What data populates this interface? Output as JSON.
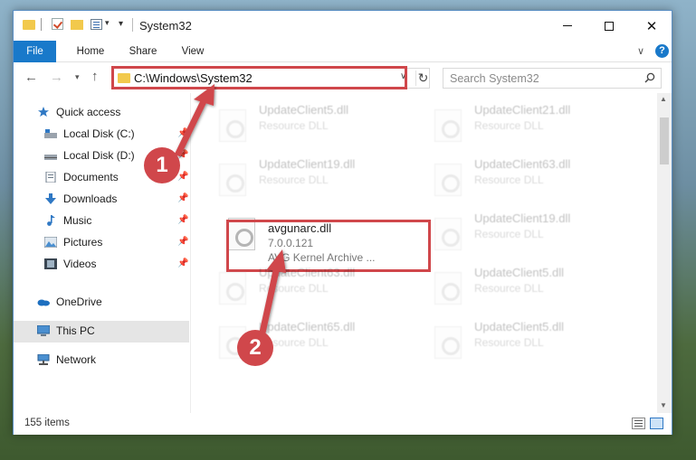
{
  "window": {
    "title": "System32"
  },
  "ribbon": {
    "tabs": [
      {
        "label": "File"
      },
      {
        "label": "Home"
      },
      {
        "label": "Share"
      },
      {
        "label": "View"
      }
    ]
  },
  "address": {
    "path": "C:\\Windows\\System32"
  },
  "search": {
    "placeholder": "Search System32"
  },
  "sidebar": {
    "items": [
      {
        "label": "Quick access",
        "icon": "star-icon",
        "pinned": false
      },
      {
        "label": "Local Disk (C:)",
        "icon": "drive-icon",
        "pinned": true
      },
      {
        "label": "Local Disk (D:)",
        "icon": "drive-icon",
        "pinned": true
      },
      {
        "label": "Documents",
        "icon": "documents-icon",
        "pinned": true
      },
      {
        "label": "Downloads",
        "icon": "downloads-icon",
        "pinned": true
      },
      {
        "label": "Music",
        "icon": "music-icon",
        "pinned": true
      },
      {
        "label": "Pictures",
        "icon": "pictures-icon",
        "pinned": true
      },
      {
        "label": "Videos",
        "icon": "videos-icon",
        "pinned": true
      },
      {
        "label": "OneDrive",
        "icon": "cloud-icon",
        "pinned": false
      },
      {
        "label": "This PC",
        "icon": "computer-icon",
        "pinned": false,
        "selected": true
      },
      {
        "label": "Network",
        "icon": "network-icon",
        "pinned": false
      }
    ]
  },
  "files": [
    {
      "name": "UpdateClient5.dll",
      "line1": "Resource DLL",
      "line2": "",
      "faded": true
    },
    {
      "name": "UpdateClient21.dll",
      "line1": "Resource DLL",
      "line2": "",
      "faded": true
    },
    {
      "name": "UpdateClient19.dll",
      "line1": "Resource DLL",
      "line2": "",
      "faded": true
    },
    {
      "name": "UpdateClient63.dll",
      "line1": "Resource DLL",
      "line2": "",
      "faded": true
    },
    {
      "name": "avgunarc.dll",
      "line1": "7.0.0.121",
      "line2": "AVG Kernel Archive ...",
      "faded": false
    },
    {
      "name": "UpdateClient19.dll",
      "line1": "Resource DLL",
      "line2": "",
      "faded": true
    },
    {
      "name": "UpdateClient63.dll",
      "line1": "Resource DLL",
      "line2": "",
      "faded": true
    },
    {
      "name": "UpdateClient5.dll",
      "line1": "Resource DLL",
      "line2": "",
      "faded": true
    },
    {
      "name": "UpdateClient65.dll",
      "line1": "Resource DLL",
      "line2": "",
      "faded": true
    },
    {
      "name": "UpdateClient5.dll",
      "line1": "Resource DLL",
      "line2": "",
      "faded": true
    }
  ],
  "status": {
    "item_count": "155 items"
  },
  "annotations": [
    {
      "label": "1"
    },
    {
      "label": "2"
    }
  ],
  "colors": {
    "accent": "#1979ca",
    "highlight": "#d0474b",
    "folder": "#f2c94c"
  }
}
